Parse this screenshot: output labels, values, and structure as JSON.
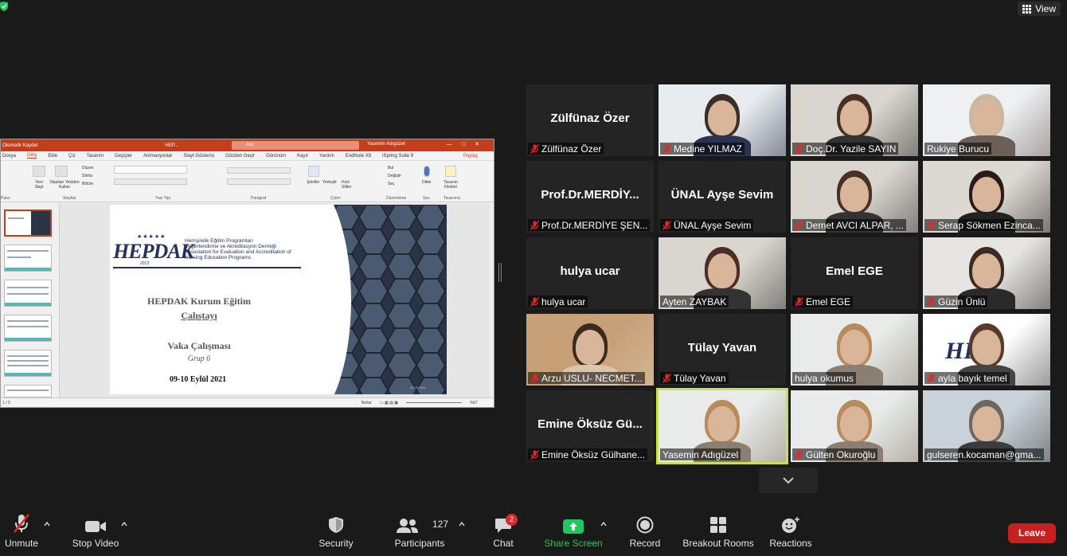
{
  "top_bar": {
    "view_label": "View"
  },
  "shared_screen": {
    "app_title": "HEP...",
    "search_placeholder": "Ara",
    "autosave": "Otomatik Kaydet",
    "user": "Yasemin Adıgüzel",
    "user_initials": "YA",
    "tabs": [
      "Dosya",
      "Giriş",
      "Ekle",
      "Çiz",
      "Tasarım",
      "Geçişler",
      "Animasyonlar",
      "Slayt Gösterisi",
      "Gözden Geçir",
      "Görünüm",
      "Kayıt",
      "Yardım",
      "EndNote X8",
      "iSpring Suite 9"
    ],
    "active_tab": "Giriş",
    "share_label": "Paylaş",
    "ribbon_groups": [
      "Pano",
      "Slaytlar",
      "Yazı Tipi",
      "Paragraf",
      "Çizim",
      "Düzenleme",
      "Ses",
      "Tasarımcı"
    ],
    "ribbon_buttons": {
      "new_slide": "Yeni Slayt",
      "reuse_slides": "Slaytları Yeniden Kullan",
      "layout": "Düzen",
      "reset": "Sıfırla",
      "section": "Bölüm",
      "shapes": "Şekiller",
      "arrange": "Yerleştir",
      "quick_styles": "Hızlı Stiller",
      "find": "Bul",
      "replace": "Değiştir",
      "select": "Seç",
      "dictate": "Dikte",
      "design_ideas": "Tasarım Fikirleri"
    },
    "slide": {
      "logo_word": "HEPDAK",
      "logo_year": "2013",
      "logo_text": [
        "Hemşirelik Eğitim Programları",
        "Değerlendirme ve Akreditasyon Derneği",
        "Association for Evaluation and Accreditation of",
        "Nursing Education Programs"
      ],
      "title_line1": "HEPDAK Kurum Eğitim",
      "title_line2": "Çalıştayı",
      "subtitle1": "Vaka Çalışması",
      "subtitle2": "Grup 6",
      "date": "09-10 Eylül 2021",
      "footer_date": "10.09.2021"
    },
    "status": {
      "slide_count": "1 / 9",
      "notes": "Notlar",
      "zoom": "%67"
    }
  },
  "participants_gallery": [
    {
      "name": "Zülfünaz Özer",
      "big_name": "Zülfünaz Özer",
      "video": false,
      "muted": true
    },
    {
      "name": "Medine YILMAZ",
      "video": true,
      "muted": true,
      "scene": "bookshelf"
    },
    {
      "name": "Doç.Dr. Yazile SAYIN",
      "video": true,
      "muted": true,
      "scene": "office"
    },
    {
      "name": "Rukiye Burucu",
      "video": true,
      "muted": false,
      "scene": "window"
    },
    {
      "name": "Prof.Dr.MERDİYE ŞEN...",
      "big_name": "Prof.Dr.MERDİY...",
      "video": false,
      "muted": true
    },
    {
      "name": "ÜNAL Ayşe Sevim",
      "big_name": "ÜNAL Ayşe Sevim",
      "video": false,
      "muted": true
    },
    {
      "name": "Demet AVCI ALPAR, ...",
      "video": true,
      "muted": true,
      "scene": "office"
    },
    {
      "name": "Serap Sökmen Ezinca...",
      "video": true,
      "muted": true,
      "scene": "shelf"
    },
    {
      "name": "hulya ucar",
      "big_name": "hulya ucar",
      "video": false,
      "muted": true
    },
    {
      "name": "Ayten ZAYBAK",
      "video": true,
      "muted": false,
      "scene": "office"
    },
    {
      "name": "Emel EGE",
      "big_name": "Emel EGE",
      "video": false,
      "muted": true
    },
    {
      "name": "Güzin Ünlü",
      "video": true,
      "muted": true,
      "scene": "room"
    },
    {
      "name": "Arzu USLU- NECMET...",
      "video": true,
      "muted": true,
      "scene": "wood"
    },
    {
      "name": "Tülay Yavan",
      "big_name": "Tülay Yavan",
      "video": false,
      "muted": true
    },
    {
      "name": "hulya okumus",
      "video": true,
      "muted": false,
      "scene": "light"
    },
    {
      "name": "ayla bayık temel",
      "video": true,
      "muted": true,
      "scene": "hepdak"
    },
    {
      "name": "Emine Öksüz Gülhane...",
      "big_name": "Emine Öksüz Gü...",
      "video": false,
      "muted": true
    },
    {
      "name": "Yasemin Adıgüzel",
      "video": true,
      "muted": false,
      "scene": "light",
      "active_speaker": true
    },
    {
      "name": "Gülten Okuroğlu",
      "video": true,
      "muted": true,
      "scene": "light"
    },
    {
      "name": "gulseren.kocaman@gma...",
      "video": true,
      "muted": false,
      "scene": "blur"
    }
  ],
  "toolbar": {
    "unmute": "Unmute",
    "stop_video": "Stop Video",
    "security": "Security",
    "participants": "Participants",
    "participants_count": "127",
    "chat": "Chat",
    "chat_badge": "2",
    "share_screen": "Share Screen",
    "record": "Record",
    "breakout_rooms": "Breakout Rooms",
    "reactions": "Reactions",
    "leave": "Leave"
  },
  "colors": {
    "background": "#1a1a1a",
    "tile": "#242424",
    "muted_red": "#e02828",
    "share_green": "#22c55e",
    "leave_red": "#c81f1f",
    "active_speaker": "#c6e24a",
    "ppt_accent": "#c43e1c"
  }
}
